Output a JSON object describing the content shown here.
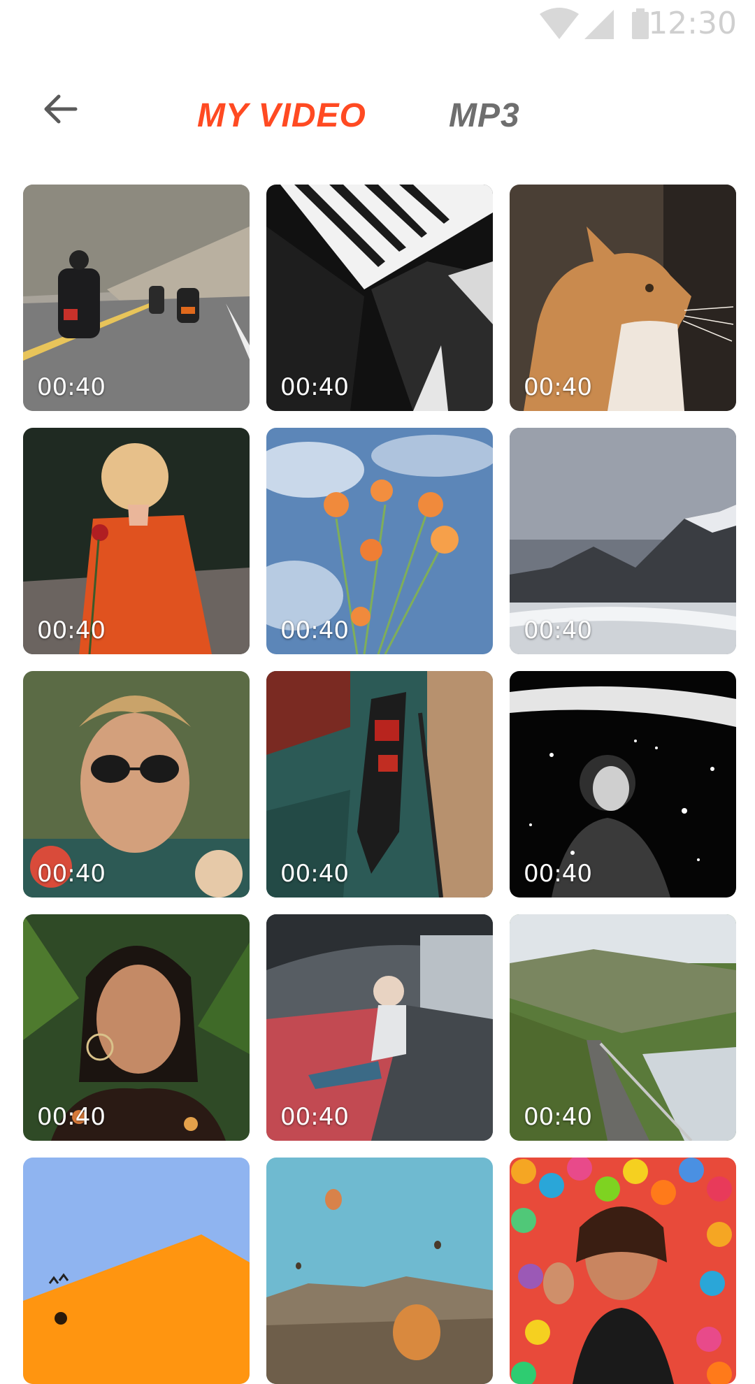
{
  "status_bar": {
    "time": "12:30",
    "icons": [
      "wifi-icon",
      "signal-icon",
      "battery-icon"
    ]
  },
  "header": {
    "back_icon": "arrow-left-icon",
    "tabs": [
      {
        "label": "MY VIDEO",
        "active": true
      },
      {
        "label": "MP3",
        "active": false
      }
    ]
  },
  "colors": {
    "accent": "#ff4a22",
    "inactive_tab": "#6e6e6e",
    "status_text": "#cfcfcf"
  },
  "videos": [
    {
      "subject": "motorcycles-road",
      "duration": "00:40"
    },
    {
      "subject": "building-architecture",
      "duration": "00:40"
    },
    {
      "subject": "cat",
      "duration": "00:40"
    },
    {
      "subject": "person-with-rose",
      "duration": "00:40"
    },
    {
      "subject": "flowers-sky",
      "duration": "00:40"
    },
    {
      "subject": "mountain-lake",
      "duration": "00:40"
    },
    {
      "subject": "man-sunglasses",
      "duration": "00:40"
    },
    {
      "subject": "gondola-canal",
      "duration": "00:40"
    },
    {
      "subject": "girl-umbrella-snow",
      "duration": "00:40"
    },
    {
      "subject": "woman-portrait",
      "duration": "00:40"
    },
    {
      "subject": "girl-tunnel",
      "duration": "00:40"
    },
    {
      "subject": "coastal-road",
      "duration": "00:40"
    },
    {
      "subject": "orange-wall-sky",
      "duration": ""
    },
    {
      "subject": "hot-air-balloons",
      "duration": ""
    },
    {
      "subject": "woman-colorful-balls",
      "duration": ""
    }
  ]
}
